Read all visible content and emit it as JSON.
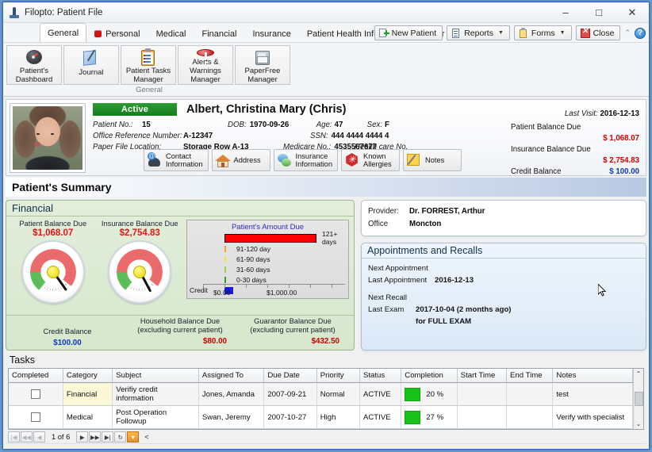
{
  "window": {
    "title": "Filopto: Patient File",
    "icon": "app-icon",
    "minimize": "–",
    "maximize": "□",
    "close": "✕"
  },
  "tabs": [
    {
      "label": "General",
      "active": true,
      "dot": false
    },
    {
      "label": "Personal",
      "active": false,
      "dot": true
    },
    {
      "label": "Medical",
      "active": false,
      "dot": false
    },
    {
      "label": "Financial",
      "active": false,
      "dot": false
    },
    {
      "label": "Insurance",
      "active": false,
      "dot": false
    },
    {
      "label": "Patient Health Information Manager",
      "active": false,
      "dot": false
    }
  ],
  "toolbar": {
    "new_patient": "New Patient",
    "reports": "Reports",
    "forms": "Forms",
    "close": "Close",
    "caret": "▼",
    "collapse": "⌃",
    "help": "?"
  },
  "ribbon": {
    "group_label": "General",
    "buttons": [
      {
        "line1": "Patient's",
        "line2": "Dashboard",
        "icon": "dashboard-icon"
      },
      {
        "line1": "Journal",
        "line2": "",
        "icon": "journal-icon"
      },
      {
        "line1": "Patient Tasks",
        "line2": "Manager",
        "icon": "clipboard-icon"
      },
      {
        "line1": "Alerts & Warnings",
        "line2": "Manager",
        "icon": "alert-icon"
      },
      {
        "line1": "PaperFree",
        "line2": "Manager",
        "icon": "filecabinet-icon"
      }
    ]
  },
  "patient": {
    "status": "Active",
    "name": "Albert, Christina Mary (Chris)",
    "fields": {
      "patient_no_label": "Patient No.:",
      "patient_no": "15",
      "dob_label": "DOB:",
      "dob": "1970-09-26",
      "age_label": "Age:",
      "age": "47",
      "sex_label": "Sex:",
      "sex": "F",
      "office_ref_label": "Office Reference Number:",
      "office_ref": "A-12347",
      "ssn_label": "SSN:",
      "ssn": "444 4444 4444 4",
      "paper_file_label": "Paper File Location:",
      "paper_file": "Storage Row A-13",
      "medicare_label": "Medicare No.:",
      "medicare": "4535567677",
      "health_care_label": "Health care No.",
      "health_care": "",
      "last_visit_label": "Last Visit:",
      "last_visit": "2016-12-13"
    },
    "balances": [
      {
        "label": "Patient Balance Due",
        "value": "$ 1,068.07",
        "color": "red"
      },
      {
        "label": "Insurance Balance Due",
        "value": "$ 2,754.83",
        "color": "red"
      },
      {
        "label": "Credit Balance",
        "value": "$ 100.00",
        "color": "blue"
      }
    ],
    "actions": [
      {
        "line1": "Contact",
        "line2": "Information",
        "icon": "contact-icon"
      },
      {
        "line1": "Address",
        "line2": "",
        "icon": "home-icon"
      },
      {
        "line1": "Insurance",
        "line2": "Information",
        "icon": "insurance-icon"
      },
      {
        "line1": "Known",
        "line2": "Allergies",
        "icon": "allergy-icon"
      },
      {
        "line1": "Notes",
        "line2": "",
        "icon": "notes-icon"
      }
    ]
  },
  "summary": {
    "title": "Patient's Summary"
  },
  "financial": {
    "title": "Financial",
    "gauges": [
      {
        "label": "Patient Balance Due",
        "value": "$1,068.07",
        "needle_deg": 55
      },
      {
        "label": "Insurance Balance Due",
        "value": "$2,754.83",
        "needle_deg": 62
      }
    ],
    "footer": [
      {
        "label1": "Credit Balance",
        "label2": "",
        "value": "$100.00",
        "color": "blue"
      },
      {
        "label1": "Household Balance Due",
        "label2": "(excluding current patient)",
        "value": "$80.00",
        "color": "red"
      },
      {
        "label1": "Guarantor Balance Due",
        "label2": "(excluding current patient)",
        "value": "$432.50",
        "color": "red"
      }
    ]
  },
  "chart_data": {
    "type": "bar",
    "title": "Patient's Amount Due",
    "orientation": "horizontal",
    "xlabel": "",
    "ylabel": "",
    "categories": [
      "121+ days",
      "91-120 day",
      "61-90 days",
      "31-60 days",
      "0-30 days",
      "Credit"
    ],
    "values": [
      1068.07,
      0,
      0,
      0,
      0,
      100.0
    ],
    "colors": [
      "#ff0000",
      "#f5a623",
      "#f5e04a",
      "#9bd14f",
      "#1fa81f",
      "#1c1ce0"
    ],
    "xlim": [
      0,
      1400
    ],
    "xticks": [
      0,
      1000
    ],
    "xticklabels": [
      "$0.00",
      "$1,000.00"
    ],
    "grid": false,
    "legend": false
  },
  "provider": {
    "provider_label": "Provider:",
    "provider_value": "Dr. FORREST, Arthur",
    "office_label": "Office",
    "office_value": "Moncton"
  },
  "appointments": {
    "title": "Appointments and Recalls",
    "rows": [
      {
        "label": "Next Appointment",
        "value": ""
      },
      {
        "label": "Last Appointment",
        "value": "2016-12-13"
      },
      {
        "label": "Next Recall",
        "value": ""
      },
      {
        "label": "Last Exam",
        "value": "2017-10-04  (2 months ago)"
      },
      {
        "label": "",
        "value": "for  FULL EXAM"
      }
    ]
  },
  "tasks": {
    "title": "Tasks",
    "columns": [
      "Completed",
      "Category",
      "Subject",
      "Assigned To",
      "Due Date",
      "Priority",
      "Status",
      "Completion",
      "Start Time",
      "End Time",
      "Notes"
    ],
    "rows": [
      {
        "completed": false,
        "category": "Financial",
        "subject": "Verifiy credit information",
        "assigned_to": "Jones, Amanda",
        "due_date": "2007-09-21",
        "priority": "Normal",
        "status": "ACTIVE",
        "completion": "20 %",
        "start_time": "",
        "end_time": "",
        "notes": "test",
        "highlight_category": true
      },
      {
        "completed": false,
        "category": "Medical",
        "subject": "Post Operation Followup",
        "assigned_to": "Swan, Jeremy",
        "due_date": "2007-10-27",
        "priority": "High",
        "status": "ACTIVE",
        "completion": "27 %",
        "start_time": "",
        "end_time": "",
        "notes": "Verify with specialist",
        "highlight_category": false
      }
    ],
    "pager": {
      "first": "|◀",
      "prev_page": "◀◀",
      "prev": "◀",
      "count": "1 of 6",
      "next": "▶",
      "next_page": "▶▶",
      "last": "▶|",
      "refresh": "↻",
      "filter": "▼",
      "expand": "<"
    },
    "scroll_up": "⌃",
    "scroll_down": "⌄"
  },
  "colors": {
    "accent_blue": "#2a6cc4",
    "status_green": "#1a8a22",
    "balance_red": "#d00000",
    "credit_blue": "#0b39c8",
    "panel_green": "#d6e7cd",
    "chart_red": "#ff0000",
    "progress_green": "#19c219"
  }
}
